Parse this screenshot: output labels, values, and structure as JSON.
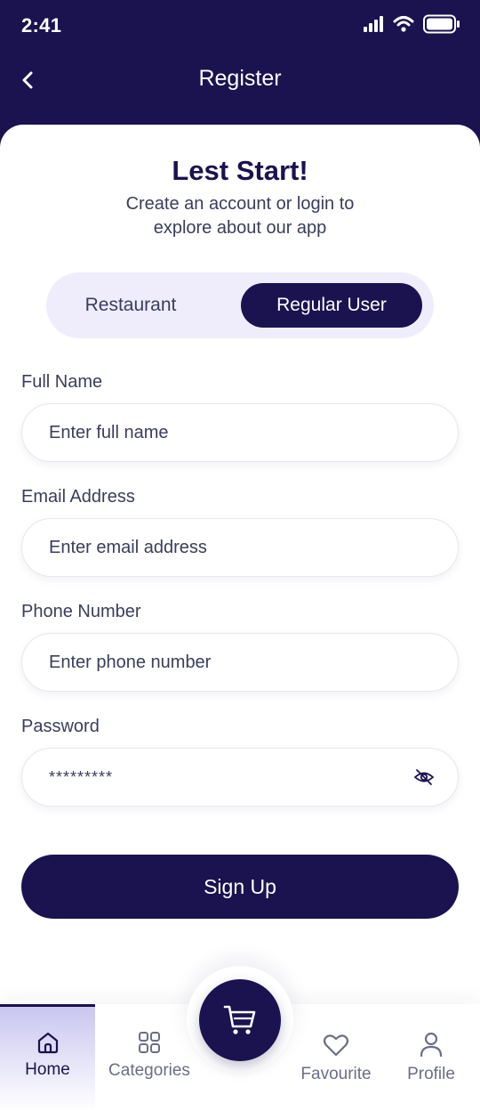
{
  "status_bar": {
    "time": "2:41",
    "icons": [
      "signal-icon",
      "wifi-icon",
      "battery-icon"
    ]
  },
  "header": {
    "title": "Register",
    "back_icon": "chevron-left-icon"
  },
  "hero": {
    "title": "Lest Start!",
    "subtitle": "Create an account or login to explore about our app"
  },
  "segment": {
    "options": [
      "Restaurant",
      "Regular User"
    ],
    "selected": "Regular User"
  },
  "form": {
    "full_name": {
      "label": "Full Name",
      "placeholder": "Enter full name"
    },
    "email": {
      "label": "Email Address",
      "placeholder": "Enter email address"
    },
    "phone": {
      "label": "Phone Number",
      "placeholder": "Enter phone number"
    },
    "password": {
      "label": "Password",
      "value": "*********",
      "toggle_icon": "eye-off-icon"
    }
  },
  "signup_label": "Sign Up",
  "bottom_nav": {
    "items": [
      {
        "label": "Home",
        "icon": "home-icon",
        "active": true
      },
      {
        "label": "Categories",
        "icon": "grid-icon",
        "active": false
      },
      {
        "label": "Favourite",
        "icon": "heart-icon",
        "active": false
      },
      {
        "label": "Profile",
        "icon": "user-icon",
        "active": false
      }
    ],
    "center_icon": "cart-icon"
  },
  "colors": {
    "primary": "#1b1250",
    "segment_bg": "#efedfb",
    "text_muted": "#3a3d5c",
    "nav_inactive": "#6b6e85"
  }
}
